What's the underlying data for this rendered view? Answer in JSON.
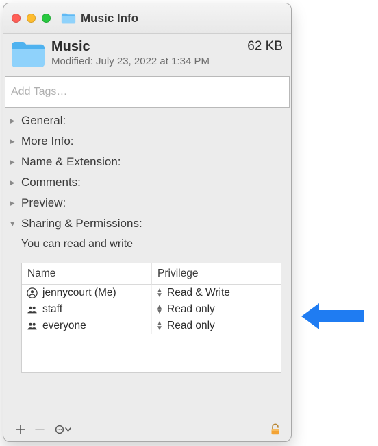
{
  "window": {
    "title": "Music Info"
  },
  "header": {
    "name": "Music",
    "size": "62 KB",
    "modified": "Modified: July 23, 2022 at 1:34 PM"
  },
  "tags": {
    "placeholder": "Add Tags…"
  },
  "sections": [
    "General:",
    "More Info:",
    "Name & Extension:",
    "Comments:",
    "Preview:",
    "Sharing & Permissions:"
  ],
  "permissions": {
    "summary": "You can read and write",
    "columns": [
      "Name",
      "Privilege"
    ],
    "rows": [
      {
        "name": "jennycourt (Me)",
        "privilege": "Read & Write",
        "icon": "person-icon"
      },
      {
        "name": "staff",
        "privilege": "Read only",
        "icon": "group-icon"
      },
      {
        "name": "everyone",
        "privilege": "Read only",
        "icon": "group-icon"
      }
    ]
  },
  "footer": {
    "buttons": [
      "add",
      "remove",
      "action-menu"
    ],
    "lock_state": "locked"
  },
  "annotation": {
    "arrow_color": "#1f7cf2"
  }
}
